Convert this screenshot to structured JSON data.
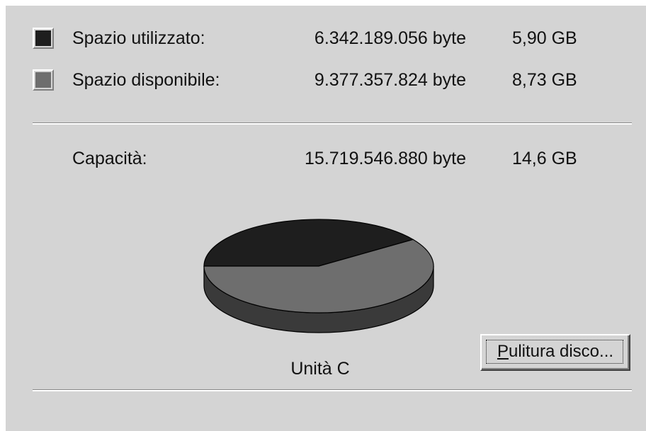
{
  "colors": {
    "used": "#1e1e1e",
    "free": "#6e6e6e",
    "used_side": "#111111",
    "free_side": "#3a3a3a",
    "panel": "#d4d4d4"
  },
  "used": {
    "label": "Spazio utilizzato:",
    "bytes": "6.342.189.056 byte",
    "gb": "5,90 GB"
  },
  "free": {
    "label": "Spazio disponibile:",
    "bytes": "9.377.357.824 byte",
    "gb": "8,73 GB"
  },
  "capacity": {
    "label": "Capacità:",
    "bytes": "15.719.546.880 byte",
    "gb": "14,6 GB"
  },
  "drive": {
    "label": "Unità C"
  },
  "cleanup_button": {
    "mnemonic": "P",
    "rest": "ulitura disco..."
  },
  "chart_data": {
    "type": "pie",
    "categories": [
      "Spazio utilizzato",
      "Spazio disponibile"
    ],
    "values": [
      6342189056,
      9377357824
    ],
    "unit": "byte"
  }
}
